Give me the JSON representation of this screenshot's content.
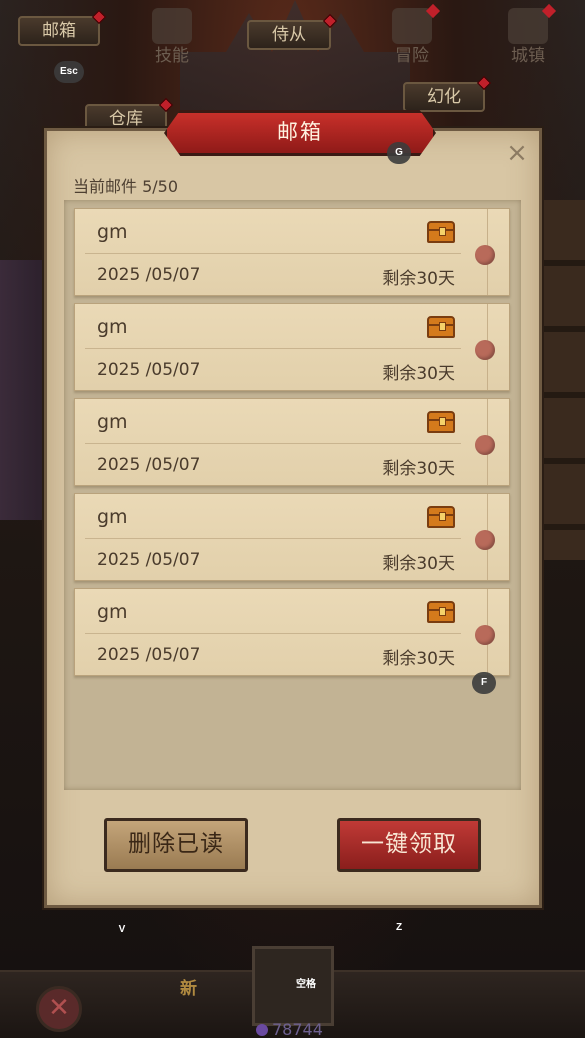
{
  "top_tabs": {
    "mail": "邮箱",
    "servant": "侍从",
    "warehouse": "仓库",
    "illusion": "幻化"
  },
  "key_hints": {
    "esc": "Esc",
    "g": "G",
    "f": "F",
    "v": "V",
    "z": "Z",
    "space": "空格"
  },
  "panel": {
    "title": "邮箱",
    "close_label": "×",
    "mail_count": "当前邮件 5/50"
  },
  "mails": [
    {
      "sender": "gm",
      "date": "2025 /05/07",
      "remaining": "剩余30天"
    },
    {
      "sender": "gm",
      "date": "2025 /05/07",
      "remaining": "剩余30天"
    },
    {
      "sender": "gm",
      "date": "2025 /05/07",
      "remaining": "剩余30天"
    },
    {
      "sender": "gm",
      "date": "2025 /05/07",
      "remaining": "剩余30天"
    },
    {
      "sender": "gm",
      "date": "2025 /05/07",
      "remaining": "剩余30天"
    }
  ],
  "buttons": {
    "delete_read": "删除已读",
    "claim_all": "一键领取"
  },
  "bottom_bar": {
    "skills": "技能",
    "new_badge": "新",
    "gems": "78744",
    "adventure": "冒险",
    "town": "城镇"
  },
  "colors": {
    "panel_bg": "#d8c6a4",
    "title_red": "#c8302a",
    "claim_red": "#8a1e1c",
    "badge_red": "#c0202a"
  }
}
